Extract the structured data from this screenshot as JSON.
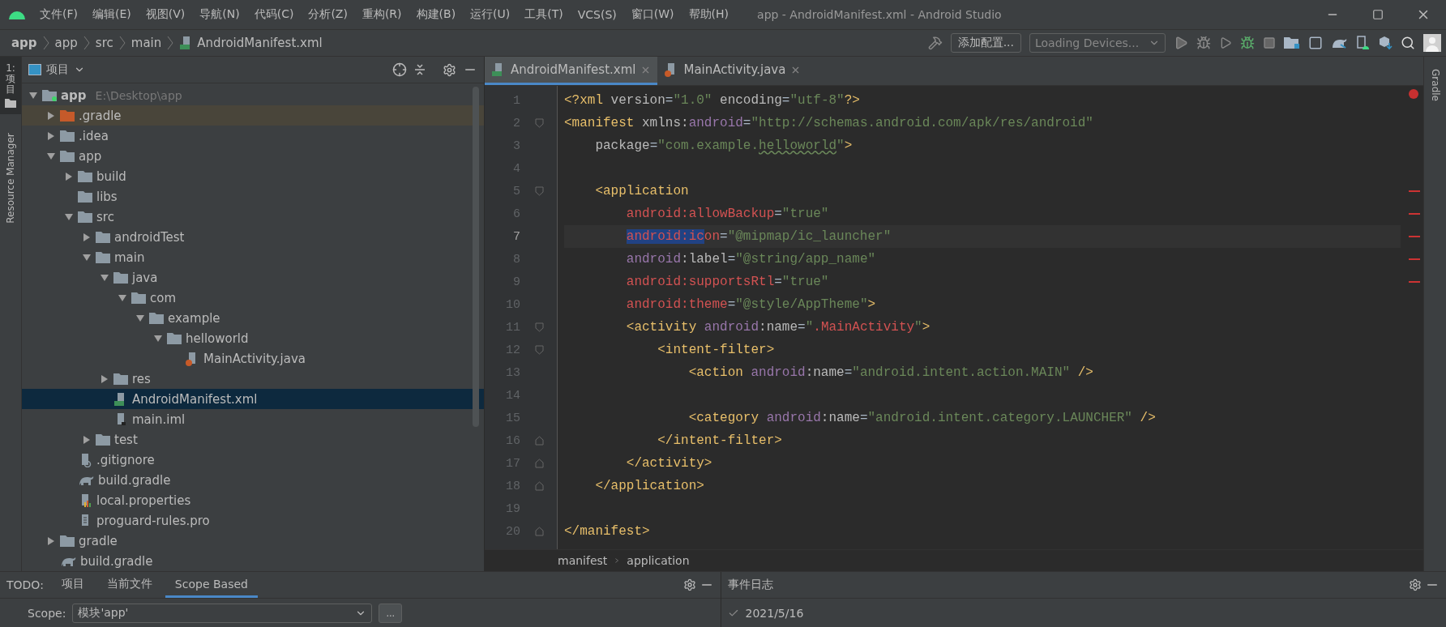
{
  "window": {
    "title": "app - AndroidManifest.xml - Android Studio"
  },
  "menu": [
    "文件(F)",
    "编辑(E)",
    "视图(V)",
    "导航(N)",
    "代码(C)",
    "分析(Z)",
    "重构(R)",
    "构建(B)",
    "运行(U)",
    "工具(T)",
    "VCS(S)",
    "窗口(W)",
    "帮助(H)"
  ],
  "breadcrumbs": [
    {
      "label": "app",
      "kind": "module"
    },
    {
      "label": "app",
      "kind": "folder"
    },
    {
      "label": "src",
      "kind": "folder"
    },
    {
      "label": "main",
      "kind": "folder"
    },
    {
      "label": "AndroidManifest.xml",
      "kind": "manifest"
    }
  ],
  "toolbar": {
    "config_button": "添加配置...",
    "device_select": "Loading Devices..."
  },
  "side_tabs": {
    "left": [
      {
        "label": "1: 项目",
        "selected": true
      },
      {
        "label": "Resource Manager",
        "selected": false
      }
    ],
    "right": [
      {
        "label": "Gradle",
        "selected": false
      }
    ]
  },
  "project_panel": {
    "title": "项目",
    "tree": [
      {
        "label": "app",
        "path": "E:\\Desktop\\app",
        "kind": "module",
        "expanded": true,
        "selected": false,
        "children": [
          {
            "label": ".gradle",
            "kind": "excluded",
            "expanded": false,
            "selected": false
          },
          {
            "label": ".idea",
            "kind": "folder",
            "expanded": false,
            "selected": false
          },
          {
            "label": "app",
            "kind": "folder",
            "expanded": true,
            "selected": false,
            "children": [
              {
                "label": "build",
                "kind": "folder",
                "expanded": false,
                "selected": false
              },
              {
                "label": "libs",
                "kind": "folder",
                "selected": false
              },
              {
                "label": "src",
                "kind": "folder",
                "expanded": true,
                "selected": false,
                "children": [
                  {
                    "label": "androidTest",
                    "kind": "folder",
                    "expanded": false,
                    "selected": false
                  },
                  {
                    "label": "main",
                    "kind": "folder",
                    "expanded": true,
                    "selected": false,
                    "children": [
                      {
                        "label": "java",
                        "kind": "folder",
                        "expanded": true,
                        "selected": false,
                        "children": [
                          {
                            "label": "com",
                            "kind": "folder",
                            "expanded": true,
                            "selected": false,
                            "children": [
                              {
                                "label": "example",
                                "kind": "folder",
                                "expanded": true,
                                "selected": false,
                                "children": [
                                  {
                                    "label": "helloworld",
                                    "kind": "folder",
                                    "expanded": true,
                                    "selected": false,
                                    "children": [
                                      {
                                        "label": "MainActivity.java",
                                        "kind": "java",
                                        "selected": false
                                      }
                                    ]
                                  }
                                ]
                              }
                            ]
                          }
                        ]
                      },
                      {
                        "label": "res",
                        "kind": "folder",
                        "expanded": false,
                        "selected": false
                      },
                      {
                        "label": "AndroidManifest.xml",
                        "kind": "manifest",
                        "selected": true
                      },
                      {
                        "label": "main.iml",
                        "kind": "iml",
                        "selected": false
                      }
                    ]
                  },
                  {
                    "label": "test",
                    "kind": "folder",
                    "expanded": false,
                    "selected": false
                  }
                ]
              },
              {
                "label": ".gitignore",
                "kind": "gitignore",
                "selected": false
              },
              {
                "label": "build.gradle",
                "kind": "gradle",
                "selected": false
              },
              {
                "label": "local.properties",
                "kind": "properties",
                "selected": false
              },
              {
                "label": "proguard-rules.pro",
                "kind": "file",
                "selected": false
              }
            ]
          },
          {
            "label": "gradle",
            "kind": "folder",
            "expanded": false,
            "selected": false
          },
          {
            "label": "build.gradle",
            "kind": "gradle",
            "selected": false
          }
        ]
      }
    ]
  },
  "editor": {
    "tabs": [
      {
        "label": "AndroidManifest.xml",
        "kind": "manifest",
        "selected": true
      },
      {
        "label": "MainActivity.java",
        "kind": "java",
        "selected": false
      }
    ],
    "lines": [
      {
        "number": "1",
        "current": false,
        "marked": false,
        "tokens": [
          {
            "t": "<?xml ",
            "color": "#e8bf6a"
          },
          {
            "t": "version",
            "color": "#bababa"
          },
          {
            "t": "=",
            "color": "#a9b7c6"
          },
          {
            "t": "\"1.0\" ",
            "color": "#6a8759"
          },
          {
            "t": "encoding",
            "color": "#bababa"
          },
          {
            "t": "=",
            "color": "#a9b7c6"
          },
          {
            "t": "\"utf-8\"",
            "color": "#6a8759"
          },
          {
            "t": "?>",
            "color": "#e8bf6a"
          }
        ]
      },
      {
        "number": "2",
        "fold_start": true,
        "current": false,
        "marked": false,
        "tokens": [
          {
            "t": "<manifest ",
            "color": "#e8bf6a"
          },
          {
            "t": "xmlns:",
            "color": "#bababa"
          },
          {
            "t": "android",
            "color": "#9876aa"
          },
          {
            "t": "=",
            "color": "#a9b7c6"
          },
          {
            "t": "\"http://schemas.android.com/apk/res/android\"",
            "color": "#6a8759"
          }
        ]
      },
      {
        "number": "3",
        "current": false,
        "marked": false,
        "tokens": [
          {
            "t": "    package",
            "color": "#bababa"
          },
          {
            "t": "=",
            "color": "#a9b7c6"
          },
          {
            "t": "\"com.example.",
            "color": "#6a8759"
          },
          {
            "t": "helloworld",
            "color": "#6a8759",
            "typo": true
          },
          {
            "t": "\"",
            "color": "#6a8759"
          },
          {
            "t": ">",
            "color": "#e8bf6a"
          }
        ]
      },
      {
        "number": "4",
        "current": false,
        "marked": false
      },
      {
        "number": "5",
        "fold_start": true,
        "current": false,
        "marked": true,
        "tokens": [
          {
            "t": "    <application",
            "color": "#e8bf6a"
          }
        ]
      },
      {
        "number": "6",
        "current": false,
        "marked": true,
        "tokens": [
          {
            "t": "        android:allowBackup",
            "color": "#d25252"
          },
          {
            "t": "=",
            "color": "#a9b7c6"
          },
          {
            "t": "\"true\"",
            "color": "#6a8759"
          }
        ]
      },
      {
        "number": "7",
        "current": true,
        "marked": true,
        "tokens": [
          {
            "t": "        android:ic",
            "selected": true
          },
          {
            "t": "on",
            "color": "#d25252"
          },
          {
            "t": "=",
            "color": "#a9b7c6"
          },
          {
            "t": "\"@mipmap/ic_launcher\"",
            "color": "#6a8759"
          }
        ]
      },
      {
        "number": "8",
        "current": false,
        "marked": true,
        "tokens": [
          {
            "t": "        android",
            "color": "#9876aa"
          },
          {
            "t": ":label",
            "color": "#bababa"
          },
          {
            "t": "=",
            "color": "#a9b7c6"
          },
          {
            "t": "\"@string/app_name\"",
            "color": "#6a8759"
          }
        ]
      },
      {
        "number": "9",
        "current": false,
        "marked": true,
        "tokens": [
          {
            "t": "        android:supportsRtl",
            "color": "#d25252"
          },
          {
            "t": "=",
            "color": "#a9b7c6"
          },
          {
            "t": "\"true\"",
            "color": "#6a8759"
          }
        ]
      },
      {
        "number": "10",
        "current": false,
        "marked": false,
        "tokens": [
          {
            "t": "        android:theme",
            "color": "#d25252"
          },
          {
            "t": "=",
            "color": "#a9b7c6"
          },
          {
            "t": "\"@style/AppTheme\"",
            "color": "#6a8759"
          },
          {
            "t": ">",
            "color": "#e8bf6a"
          }
        ]
      },
      {
        "number": "11",
        "fold_start": true,
        "current": false,
        "marked": false,
        "tokens": [
          {
            "t": "        <activity ",
            "color": "#e8bf6a"
          },
          {
            "t": "android",
            "color": "#9876aa"
          },
          {
            "t": ":name",
            "color": "#bababa"
          },
          {
            "t": "=",
            "color": "#a9b7c6"
          },
          {
            "t": "\"",
            "color": "#6a8759"
          },
          {
            "t": ".MainActivity",
            "color": "#d25252"
          },
          {
            "t": "\"",
            "color": "#6a8759"
          },
          {
            "t": ">",
            "color": "#e8bf6a"
          }
        ]
      },
      {
        "number": "12",
        "fold_start": true,
        "current": false,
        "marked": false,
        "tokens": [
          {
            "t": "            <intent-filter>",
            "color": "#e8bf6a"
          }
        ]
      },
      {
        "number": "13",
        "current": false,
        "marked": false,
        "tokens": [
          {
            "t": "                <action ",
            "color": "#e8bf6a"
          },
          {
            "t": "android",
            "color": "#9876aa"
          },
          {
            "t": ":name",
            "color": "#bababa"
          },
          {
            "t": "=",
            "color": "#a9b7c6"
          },
          {
            "t": "\"android.intent.action.MAIN\" ",
            "color": "#6a8759"
          },
          {
            "t": "/>",
            "color": "#e8bf6a"
          }
        ]
      },
      {
        "number": "14",
        "current": false,
        "marked": false
      },
      {
        "number": "15",
        "current": false,
        "marked": false,
        "tokens": [
          {
            "t": "                <category ",
            "color": "#e8bf6a"
          },
          {
            "t": "android",
            "color": "#9876aa"
          },
          {
            "t": ":name",
            "color": "#bababa"
          },
          {
            "t": "=",
            "color": "#a9b7c6"
          },
          {
            "t": "\"android.intent.category.LAUNCHER\" ",
            "color": "#6a8759"
          },
          {
            "t": "/>",
            "color": "#e8bf6a"
          }
        ]
      },
      {
        "number": "16",
        "fold_end": true,
        "current": false,
        "marked": false,
        "tokens": [
          {
            "t": "            </intent-filter>",
            "color": "#e8bf6a"
          }
        ]
      },
      {
        "number": "17",
        "fold_end": true,
        "current": false,
        "marked": false,
        "tokens": [
          {
            "t": "        </activity>",
            "color": "#e8bf6a"
          }
        ]
      },
      {
        "number": "18",
        "fold_end": true,
        "current": false,
        "marked": false,
        "tokens": [
          {
            "t": "    </application>",
            "color": "#e8bf6a"
          }
        ]
      },
      {
        "number": "19",
        "current": false,
        "marked": false
      },
      {
        "number": "20",
        "fold_end": true,
        "current": false,
        "marked": false,
        "tokens": [
          {
            "t": "</manifest>",
            "color": "#e8bf6a"
          }
        ]
      }
    ],
    "breadcrumb": [
      "manifest",
      "application"
    ]
  },
  "todo_panel": {
    "label": "TODO:",
    "tabs": [
      {
        "label": "项目",
        "selected": false
      },
      {
        "label": "当前文件",
        "selected": false
      },
      {
        "label": "Scope Based",
        "selected": true
      }
    ],
    "scope_label": "Scope:",
    "scope_value": "模块'app'",
    "more_button": "..."
  },
  "event_log": {
    "title": "事件日志",
    "entries": [
      "2021/5/16"
    ]
  }
}
